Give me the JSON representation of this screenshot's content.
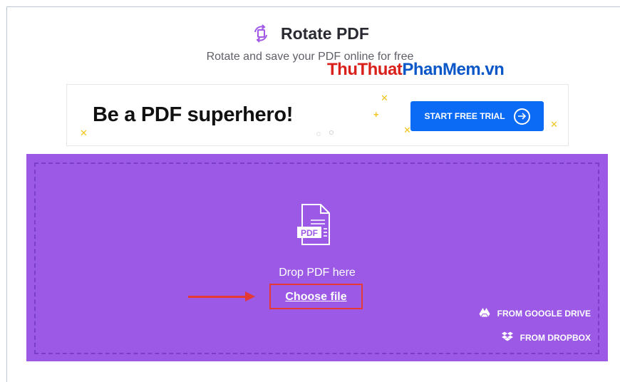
{
  "header": {
    "title": "Rotate PDF",
    "subtitle": "Rotate and save your PDF online for free",
    "icon": "rotate-icon"
  },
  "watermark": {
    "red_part": "ThuThuat",
    "blue_part": "PhanMem.vn"
  },
  "banner": {
    "headline": "Be a PDF superhero!",
    "cta_label": "START FREE TRIAL",
    "cta_icon": "arrow-right-circle-icon"
  },
  "dropzone": {
    "file_icon": "pdf-file-icon",
    "file_icon_text": "PDF",
    "drop_label": "Drop PDF here",
    "choose_label": "Choose file",
    "google_drive_label": "FROM GOOGLE DRIVE",
    "dropbox_label": "FROM DROPBOX"
  },
  "colors": {
    "accent_purple": "#9b59e6",
    "cta_blue": "#0b6bf4",
    "highlight_red": "#e53935",
    "spark_yellow": "#f3c51b"
  }
}
